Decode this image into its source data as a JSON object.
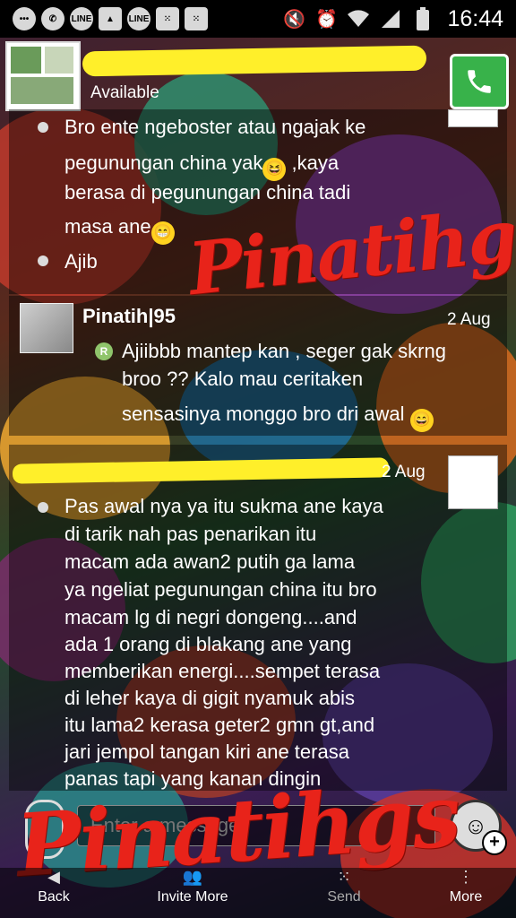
{
  "status_bar": {
    "time": "16:44",
    "left_icons": [
      "chat-bubble-icon",
      "whatsapp-icon",
      "line-icon",
      "gallery-icon",
      "line-icon",
      "blackberry-icon",
      "blackberry-icon"
    ],
    "right_icons": [
      "mute-icon",
      "alarm-icon",
      "wifi-icon",
      "signal-icon",
      "battery-icon"
    ]
  },
  "header": {
    "status": "Available",
    "call_icon": "phone-icon",
    "accent_color": "#38b24a"
  },
  "messages": [
    {
      "lines": [
        {
          "text": "Bro ente ngeboster atau ngajak ke",
          "bullet": true
        },
        {
          "text": "pegunungan china yak",
          "emoji": "laugh",
          "after": " ,kaya"
        },
        {
          "text": "berasa di pegunungan china tadi"
        },
        {
          "text": "masa ane",
          "emoji": "grin"
        },
        {
          "text": "Ajib",
          "bullet": true
        }
      ]
    },
    {
      "sender": "Pinatih|95",
      "date": "2 Aug",
      "read_mark": "R",
      "lines": [
        {
          "text": "Ajiibbb mantep kan , seger gak skrng"
        },
        {
          "text": "broo ?? Kalo mau  ceritaken"
        },
        {
          "text": "sensasinya monggo bro dri awal",
          "emoji": "grin"
        }
      ]
    },
    {
      "date": "2 Aug",
      "lines": [
        {
          "text": "Pas awal nya ya itu sukma ane kaya",
          "bullet": true
        },
        {
          "text": "di tarik nah pas penarikan itu"
        },
        {
          "text": "macam ada awan2 putih ga lama"
        },
        {
          "text": "ya ngeliat pegunungan china itu bro"
        },
        {
          "text": "macam lg di negri dongeng....and"
        },
        {
          "text": "ada 1 orang di blakang ane yang"
        },
        {
          "text": "memberikan energi....sempet terasa"
        },
        {
          "text": "di leher kaya di gigit nyamuk abis"
        },
        {
          "text": "itu lama2 kerasa geter2 gmn gt,and"
        },
        {
          "text": "jari jempol tangan kiri ane terasa"
        },
        {
          "text": "panas tapi yang kanan dingin"
        }
      ]
    }
  ],
  "watermark": "Pinatihgs",
  "input": {
    "placeholder": "Enter a message",
    "attach_icon": "paperclip-icon",
    "emoticon_icon": "smiley-icon"
  },
  "bottom_nav": [
    {
      "label": "Back",
      "icon": "back-icon"
    },
    {
      "label": "Invite More",
      "icon": "invite-icon"
    },
    {
      "label": "Send",
      "icon": "blackberry-icon"
    },
    {
      "label": "More",
      "icon": "more-icon"
    }
  ]
}
